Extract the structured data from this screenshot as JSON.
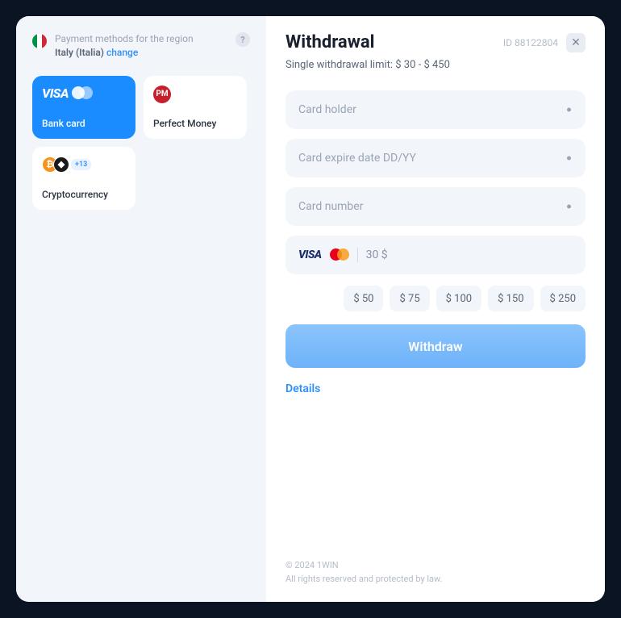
{
  "region": {
    "label": "Payment methods for the region",
    "country": "Italy (Italia)",
    "change": "change"
  },
  "methods": {
    "bankcard": {
      "label": "Bank card"
    },
    "perfect_money": {
      "label": "Perfect Money",
      "icon_text": "PM"
    },
    "crypto": {
      "label": "Cryptocurrency",
      "badge": "+13"
    }
  },
  "panel": {
    "title": "Withdrawal",
    "id": "ID 88122804",
    "limit": "Single withdrawal limit: $ 30 - $ 450"
  },
  "form": {
    "card_holder": "Card holder",
    "card_expire": "Card expire date DD/YY",
    "card_number": "Card number",
    "amount": "30 $"
  },
  "quick_amounts": [
    "$ 50",
    "$ 75",
    "$ 100",
    "$ 150",
    "$ 250"
  ],
  "actions": {
    "withdraw": "Withdraw",
    "details": "Details"
  },
  "footer": {
    "line1": "© 2024 1WIN",
    "line2": "All rights reserved and protected by law."
  }
}
